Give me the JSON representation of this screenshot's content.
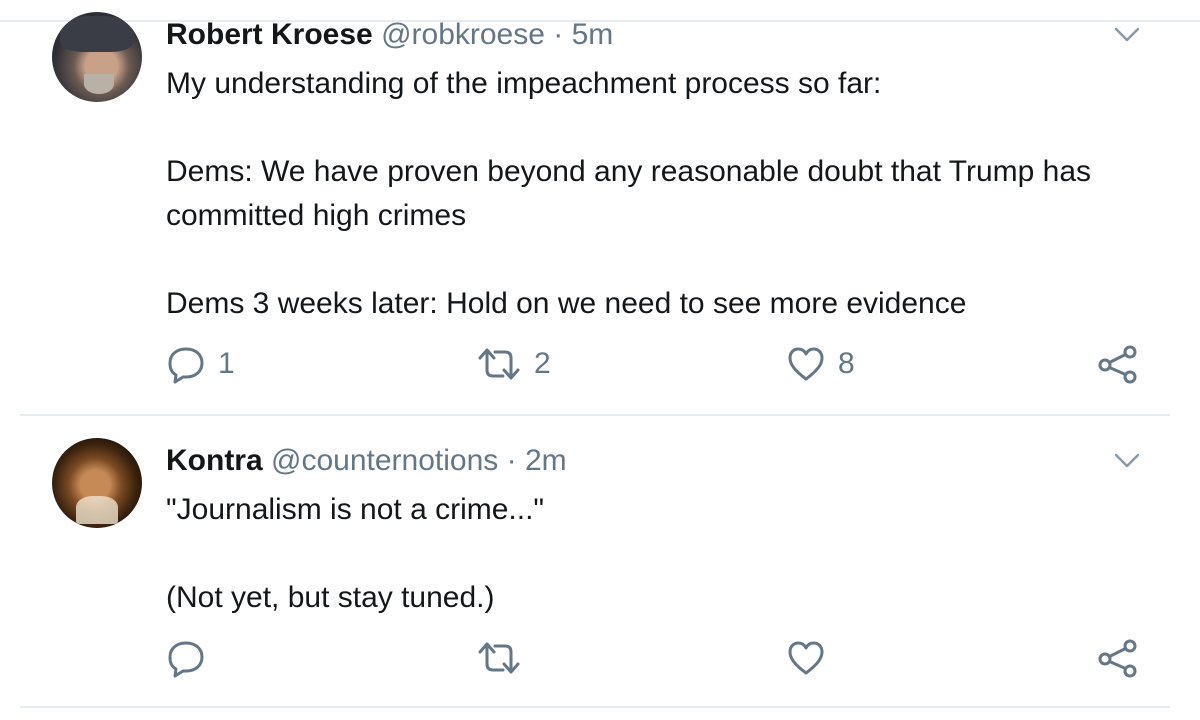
{
  "icons": [
    "chevron-down-icon",
    "reply-icon",
    "retweet-icon",
    "like-icon",
    "share-icon"
  ],
  "colors": {
    "text": "#14171a",
    "secondary": "#657786",
    "divider": "#e6ecf0"
  },
  "tweets": [
    {
      "name": "Robert Kroese",
      "handle": "@robkroese",
      "separator": "·",
      "time": "5m",
      "text": "My understanding of the impeachment process so far:\n\nDems: We have proven beyond any reasonable doubt that Trump has committed high crimes\n\nDems 3 weeks later: Hold on we need to see more evidence",
      "replies": "1",
      "retweets": "2",
      "likes": "8"
    },
    {
      "name": "Kontra",
      "handle": "@counternotions",
      "separator": "·",
      "time": "2m",
      "text": "\"Journalism is not a crime...\"\n\n(Not yet, but stay tuned.)",
      "replies": "",
      "retweets": "",
      "likes": ""
    }
  ]
}
